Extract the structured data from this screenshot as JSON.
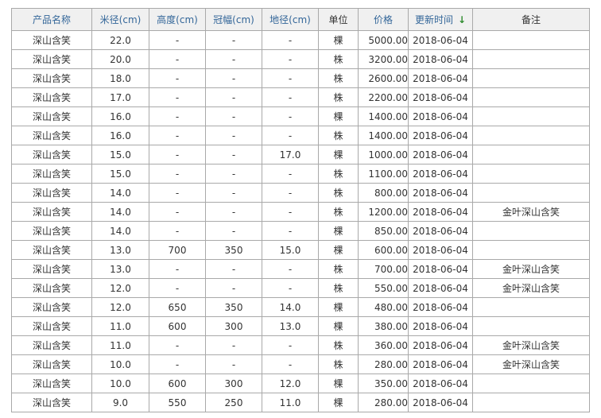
{
  "headers": {
    "name": "产品名称",
    "diameter": "米径(cm)",
    "height": "高度(cm)",
    "crown": "冠幅(cm)",
    "ground_diameter": "地径(cm)",
    "unit": "单位",
    "price": "价格",
    "updated": "更新时间",
    "remark": "备注"
  },
  "sort_icon": "arrow-down-icon",
  "rows": [
    {
      "name": "深山含笑",
      "diameter": "22.0",
      "height": "-",
      "crown": "-",
      "ground_diameter": "-",
      "unit": "棵",
      "price": "5000.00",
      "updated": "2018-06-04",
      "remark": ""
    },
    {
      "name": "深山含笑",
      "diameter": "20.0",
      "height": "-",
      "crown": "-",
      "ground_diameter": "-",
      "unit": "株",
      "price": "3200.00",
      "updated": "2018-06-04",
      "remark": ""
    },
    {
      "name": "深山含笑",
      "diameter": "18.0",
      "height": "-",
      "crown": "-",
      "ground_diameter": "-",
      "unit": "株",
      "price": "2600.00",
      "updated": "2018-06-04",
      "remark": ""
    },
    {
      "name": "深山含笑",
      "diameter": "17.0",
      "height": "-",
      "crown": "-",
      "ground_diameter": "-",
      "unit": "株",
      "price": "2200.00",
      "updated": "2018-06-04",
      "remark": ""
    },
    {
      "name": "深山含笑",
      "diameter": "16.0",
      "height": "-",
      "crown": "-",
      "ground_diameter": "-",
      "unit": "棵",
      "price": "1400.00",
      "updated": "2018-06-04",
      "remark": ""
    },
    {
      "name": "深山含笑",
      "diameter": "16.0",
      "height": "-",
      "crown": "-",
      "ground_diameter": "-",
      "unit": "株",
      "price": "1400.00",
      "updated": "2018-06-04",
      "remark": ""
    },
    {
      "name": "深山含笑",
      "diameter": "15.0",
      "height": "-",
      "crown": "-",
      "ground_diameter": "17.0",
      "unit": "棵",
      "price": "1000.00",
      "updated": "2018-06-04",
      "remark": ""
    },
    {
      "name": "深山含笑",
      "diameter": "15.0",
      "height": "-",
      "crown": "-",
      "ground_diameter": "-",
      "unit": "株",
      "price": "1100.00",
      "updated": "2018-06-04",
      "remark": ""
    },
    {
      "name": "深山含笑",
      "diameter": "14.0",
      "height": "-",
      "crown": "-",
      "ground_diameter": "-",
      "unit": "株",
      "price": "800.00",
      "updated": "2018-06-04",
      "remark": ""
    },
    {
      "name": "深山含笑",
      "diameter": "14.0",
      "height": "-",
      "crown": "-",
      "ground_diameter": "-",
      "unit": "株",
      "price": "1200.00",
      "updated": "2018-06-04",
      "remark": "金叶深山含笑"
    },
    {
      "name": "深山含笑",
      "diameter": "14.0",
      "height": "-",
      "crown": "-",
      "ground_diameter": "-",
      "unit": "棵",
      "price": "850.00",
      "updated": "2018-06-04",
      "remark": ""
    },
    {
      "name": "深山含笑",
      "diameter": "13.0",
      "height": "700",
      "crown": "350",
      "ground_diameter": "15.0",
      "unit": "棵",
      "price": "600.00",
      "updated": "2018-06-04",
      "remark": ""
    },
    {
      "name": "深山含笑",
      "diameter": "13.0",
      "height": "-",
      "crown": "-",
      "ground_diameter": "-",
      "unit": "株",
      "price": "700.00",
      "updated": "2018-06-04",
      "remark": "金叶深山含笑"
    },
    {
      "name": "深山含笑",
      "diameter": "12.0",
      "height": "-",
      "crown": "-",
      "ground_diameter": "-",
      "unit": "株",
      "price": "550.00",
      "updated": "2018-06-04",
      "remark": "金叶深山含笑"
    },
    {
      "name": "深山含笑",
      "diameter": "12.0",
      "height": "650",
      "crown": "350",
      "ground_diameter": "14.0",
      "unit": "棵",
      "price": "480.00",
      "updated": "2018-06-04",
      "remark": ""
    },
    {
      "name": "深山含笑",
      "diameter": "11.0",
      "height": "600",
      "crown": "300",
      "ground_diameter": "13.0",
      "unit": "棵",
      "price": "380.00",
      "updated": "2018-06-04",
      "remark": ""
    },
    {
      "name": "深山含笑",
      "diameter": "11.0",
      "height": "-",
      "crown": "-",
      "ground_diameter": "-",
      "unit": "株",
      "price": "360.00",
      "updated": "2018-06-04",
      "remark": "金叶深山含笑"
    },
    {
      "name": "深山含笑",
      "diameter": "10.0",
      "height": "-",
      "crown": "-",
      "ground_diameter": "-",
      "unit": "株",
      "price": "280.00",
      "updated": "2018-06-04",
      "remark": "金叶深山含笑"
    },
    {
      "name": "深山含笑",
      "diameter": "10.0",
      "height": "600",
      "crown": "300",
      "ground_diameter": "12.0",
      "unit": "棵",
      "price": "350.00",
      "updated": "2018-06-04",
      "remark": ""
    },
    {
      "name": "深山含笑",
      "diameter": "9.0",
      "height": "550",
      "crown": "250",
      "ground_diameter": "11.0",
      "unit": "棵",
      "price": "280.00",
      "updated": "2018-06-04",
      "remark": ""
    }
  ]
}
